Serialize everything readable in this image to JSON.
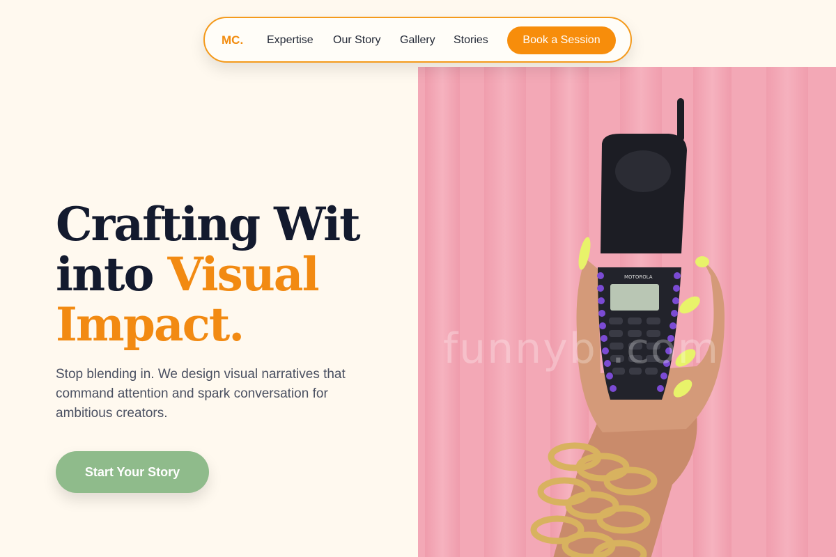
{
  "nav": {
    "logo": "MC.",
    "links": [
      "Expertise",
      "Our Story",
      "Gallery",
      "Stories"
    ],
    "cta": "Book a Session"
  },
  "hero": {
    "headline_line1": "Crafting Wit",
    "headline_line2_a": "into ",
    "headline_line2_b": "Visual",
    "headline_line3": "Impact.",
    "subtitle": "Stop blending in. We design visual narratives that command attention and spark conversation for ambitious creators.",
    "button": "Start Your Story"
  },
  "image": {
    "phone_brand": "MOTOROLA",
    "watermark": "funnyb     .com",
    "colors": {
      "curtain": "#f3a8b6",
      "nails": "#e8f36a",
      "phone": "#1c1d24",
      "gems": "#7b4bd4",
      "chain": "#d8b25f"
    }
  },
  "colors": {
    "accent": "#f28a12",
    "dark": "#131a2e",
    "green": "#8fbb8b",
    "background": "#fff9ef"
  }
}
